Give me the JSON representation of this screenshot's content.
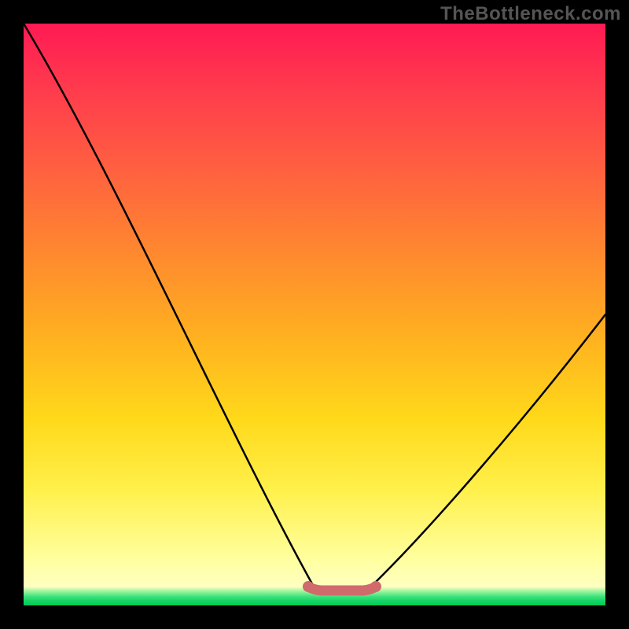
{
  "watermark": "TheBottleneck.com",
  "chart_data": {
    "type": "line",
    "title": "",
    "xlabel": "",
    "ylabel": "",
    "xlim": [
      0,
      100
    ],
    "ylim": [
      0,
      100
    ],
    "grid": false,
    "series": [
      {
        "name": "bottleneck-curve",
        "x": [
          0,
          10,
          20,
          30,
          40,
          45,
          50,
          55,
          60,
          65,
          70,
          80,
          90,
          100
        ],
        "values": [
          100,
          78,
          56,
          35,
          15,
          7,
          2,
          0,
          0,
          2,
          7,
          20,
          35,
          50
        ]
      }
    ],
    "annotations": [
      {
        "name": "optimal-segment",
        "x_range": [
          50,
          60
        ],
        "style": "thick-red"
      }
    ],
    "colors": {
      "gradient_top": "#ff1a53",
      "gradient_mid": "#ffd91a",
      "gradient_bottom_band": "#00cc55",
      "curve": "#000000",
      "highlight": "#d96a6a"
    }
  }
}
